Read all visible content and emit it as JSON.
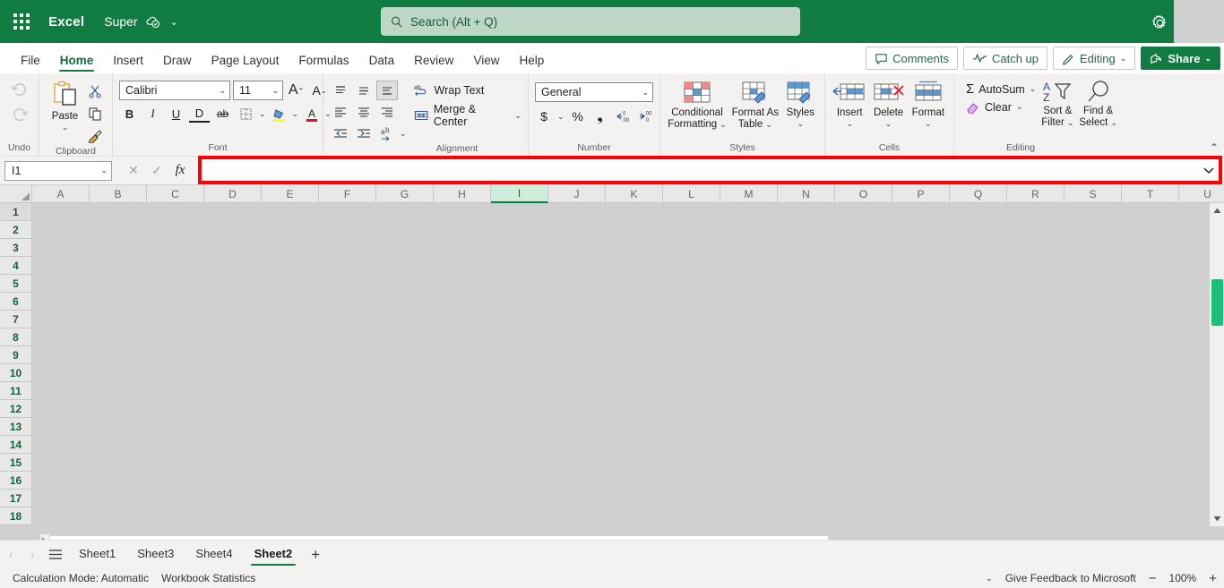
{
  "titlebar": {
    "app_launcher": "app-launcher",
    "app_name": "Excel",
    "file_name": "Super",
    "autosave_state": "saved-to-cloud",
    "file_chevron": "⌄",
    "settings_icon": "gear-icon"
  },
  "search": {
    "placeholder": "Search (Alt + Q)",
    "value": ""
  },
  "ribbon_tabs": [
    {
      "label": "File",
      "active": false
    },
    {
      "label": "Home",
      "active": true
    },
    {
      "label": "Insert",
      "active": false
    },
    {
      "label": "Draw",
      "active": false
    },
    {
      "label": "Page Layout",
      "active": false
    },
    {
      "label": "Formulas",
      "active": false
    },
    {
      "label": "Data",
      "active": false
    },
    {
      "label": "Review",
      "active": false
    },
    {
      "label": "View",
      "active": false
    },
    {
      "label": "Help",
      "active": false
    }
  ],
  "ribbon_actions": {
    "comments": "Comments",
    "catch_up": "Catch up",
    "editing": "Editing",
    "editing_chevron": "⌄",
    "share": "Share",
    "share_chevron": "⌄"
  },
  "ribbon": {
    "undo_group": {
      "label": "Undo",
      "undo": "Undo",
      "redo": "Redo"
    },
    "clipboard_group": {
      "label": "Clipboard",
      "paste": "Paste",
      "paste_chevron": "⌄",
      "cut": "Cut",
      "copy": "Copy",
      "format_painter": "Format Painter"
    },
    "font_group": {
      "label": "Font",
      "font_family": "Calibri",
      "font_size": "11",
      "grow_font": "A",
      "shrink_font": "A",
      "bold": "B",
      "italic": "I",
      "underline": "U",
      "double_underline": "D",
      "strikethrough": "ab",
      "borders": "Borders",
      "fill_color": "Fill Color",
      "font_color": "Font Color",
      "chevron": "⌄"
    },
    "alignment_group": {
      "label": "Alignment",
      "top_align": "Top Align",
      "middle_align": "Middle Align",
      "bottom_align": "Bottom Align",
      "align_left": "Align Left",
      "align_center": "Center",
      "align_right": "Align Right",
      "decrease_indent": "Decrease Indent",
      "increase_indent": "Increase Indent",
      "orientation": "Orientation",
      "wrap_text": "Wrap Text",
      "merge_center": "Merge & Center",
      "merge_chevron": "⌄"
    },
    "number_group": {
      "label": "Number",
      "format": "General",
      "accounting": "$",
      "accounting_chevron": "⌄",
      "percent": "%",
      "comma": "❟",
      "increase_decimal": "Increase Decimal",
      "decrease_decimal": "Decrease Decimal"
    },
    "styles_group": {
      "label": "Styles",
      "conditional_formatting": "Conditional\nFormatting",
      "conditional_formatting_l1": "Conditional",
      "conditional_formatting_l2": "Formatting",
      "format_as_table_l1": "Format As",
      "format_as_table_l2": "Table",
      "styles": "Styles",
      "chevron": "⌄"
    },
    "cells_group": {
      "label": "Cells",
      "insert": "Insert",
      "delete": "Delete",
      "format": "Format",
      "chevron": "⌄"
    },
    "editing_group": {
      "label": "Editing",
      "autosum": "AutoSum",
      "clear": "Clear",
      "sort_filter_l1": "Sort &",
      "sort_filter_l2": "Filter",
      "find_select_l1": "Find &",
      "find_select_l2": "Select",
      "chevron": "⌄"
    },
    "collapse": "⌃"
  },
  "formula_bar": {
    "name_box": "I1",
    "name_box_chevron": "⌄",
    "cancel": "✕",
    "enter": "✓",
    "insert_function": "fx",
    "value": "",
    "expand_chevron": "⌄",
    "highlight_color": "#ff0000"
  },
  "grid": {
    "columns": [
      "A",
      "B",
      "C",
      "D",
      "E",
      "F",
      "G",
      "H",
      "I",
      "J",
      "K",
      "L",
      "M",
      "N",
      "O",
      "P",
      "Q",
      "R",
      "S",
      "T",
      "U"
    ],
    "selected_column": "I",
    "rows": [
      "1",
      "2",
      "3",
      "4",
      "5",
      "6",
      "7",
      "8",
      "9",
      "10",
      "11",
      "12",
      "13",
      "14",
      "15",
      "16",
      "17",
      "18"
    ],
    "selected_row": "1",
    "scroll_up": "▲",
    "scroll_down": "▼"
  },
  "sheet_bar": {
    "prev": "‹",
    "next": "›",
    "all_sheets": "all-sheets-menu",
    "tabs": [
      {
        "label": "Sheet1",
        "active": false
      },
      {
        "label": "Sheet3",
        "active": false
      },
      {
        "label": "Sheet4",
        "active": false
      },
      {
        "label": "Sheet2",
        "active": true
      }
    ],
    "add_sheet": "+"
  },
  "status_bar": {
    "calculation_mode": "Calculation Mode: Automatic",
    "workbook_statistics": "Workbook Statistics",
    "options_chevron": "⌄",
    "feedback": "Give Feedback to Microsoft",
    "zoom_out": "−",
    "zoom_level": "100%",
    "zoom_in": "+"
  },
  "colors": {
    "brand_green": "#107c41",
    "search_bg": "#bdd6c6",
    "highlight_red": "#ff0000",
    "scroll_thumb": "#1bbf7a"
  }
}
